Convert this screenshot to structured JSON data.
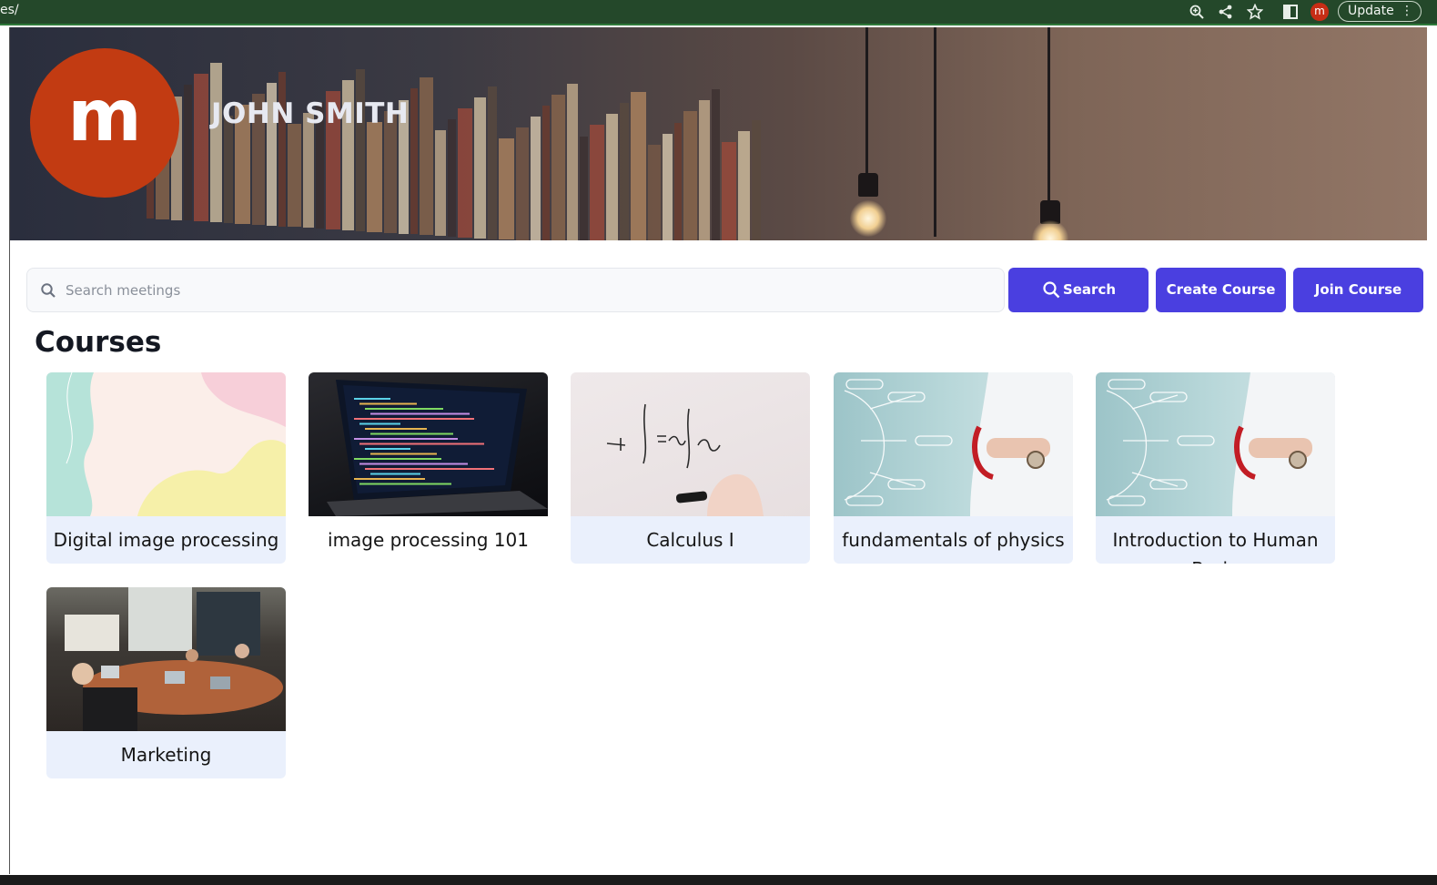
{
  "browser": {
    "url_fragment": "es/",
    "profile_initial": "m",
    "update_label": "Update",
    "icons": [
      "zoom-icon",
      "share-icon",
      "star-icon",
      "sidebar-icon"
    ]
  },
  "profile": {
    "avatar_initial": "m",
    "name": "JOHN SMITH"
  },
  "search": {
    "placeholder": "Search meetings",
    "button_label": "Search"
  },
  "actions": {
    "create_label": "Create Course",
    "join_label": "Join Course"
  },
  "section": {
    "title": "Courses"
  },
  "courses": [
    {
      "title": "Digital image processing",
      "image": "pastel-abstract"
    },
    {
      "title": "image processing 101",
      "image": "laptop-code"
    },
    {
      "title": "Calculus I",
      "image": "whiteboard-math"
    },
    {
      "title": "fundamentals of physics",
      "image": "medical-infographic"
    },
    {
      "title": "Introduction to Human Brain",
      "image": "medical-infographic"
    },
    {
      "title": "Marketing",
      "image": "team-meeting"
    }
  ],
  "colors": {
    "accent": "#4a3fe0",
    "avatar": "#c23b12",
    "card_bg": "#eaf0fc",
    "browser_bar": "#24482a"
  }
}
